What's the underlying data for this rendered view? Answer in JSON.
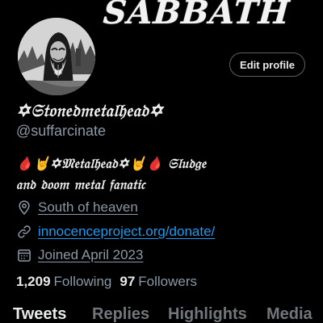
{
  "banner": {
    "text": "SABBATH",
    "ghost_text": ""
  },
  "profile": {
    "edit_label": "Edit profile",
    "display_name": "✡𝔖𝔱𝔬𝔫𝔢𝔡𝔪𝔢𝔱𝔞𝔩𝔥𝔢𝔞𝔡✡",
    "handle": "@suffarcinate",
    "bio_line1": "🩸🤘✡𝔐𝔢𝔱𝔞𝔩𝔥𝔢𝔞𝔡✡🤘🩸 𝔖𝔩𝔲𝔡𝔤𝔢",
    "bio_line2": "𝔞𝔫𝔡 𝔡𝔬𝔬𝔪 𝔪𝔢𝔱𝔞𝔩 𝔣𝔞𝔫𝔞𝔱𝔦𝔠"
  },
  "meta": {
    "location": "South of heaven",
    "website": "innocenceproject.org/donate/",
    "joined": "Joined April 2023"
  },
  "counts": {
    "following_num": "1,209",
    "following_label": "Following",
    "followers_num": "97",
    "followers_label": "Followers"
  },
  "tabs": {
    "tweets": "Tweets",
    "replies": "Replies",
    "highlights": "Highlights",
    "media": "Media"
  },
  "icons": {
    "location": "location-pin-icon",
    "link": "link-icon",
    "calendar": "calendar-icon"
  },
  "colors": {
    "background": "#000000",
    "secondary_text": "#8b98a5",
    "link": "#1d9bf0",
    "primary_text": "#e7e9ea"
  }
}
